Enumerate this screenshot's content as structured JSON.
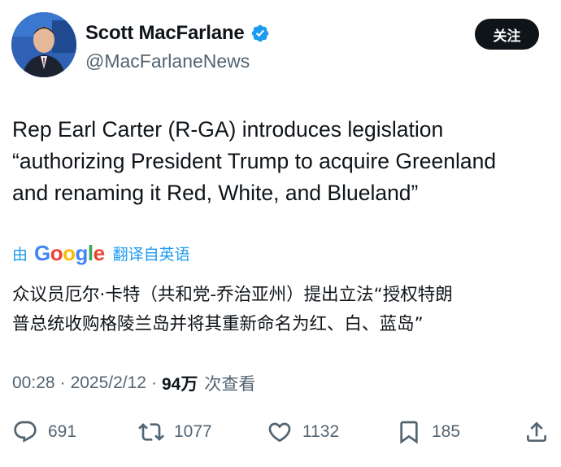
{
  "author": {
    "name": "Scott MacFarlane",
    "handle": "@MacFarlaneNews"
  },
  "follow_label": "关注",
  "tweet_text": "Rep Earl Carter (R-GA) introduces legislation\n“authorizing President Trump to acquire Greenland\nand renaming it Red, White, and Blueland”",
  "translation": {
    "prefix": "由",
    "logo_text": "Google",
    "suffix": "翻译自英语",
    "text": "众议员厄尔·卡特（共和党-乔治亚州）提出立法“授权特朗\n普总统收购格陵兰岛并将其重新命名为红、白、蓝岛”"
  },
  "meta": {
    "time": "00:28",
    "separator": "·",
    "date": "2025/2/12",
    "views": "94万",
    "views_label": "次查看"
  },
  "actions": {
    "replies": "691",
    "reposts": "1077",
    "likes": "1132",
    "bookmarks": "185"
  },
  "colors": {
    "verified_blue": "#1d9bf0",
    "link_blue": "#1d9bf0",
    "muted_gray": "#536471",
    "text_black": "#0f1419"
  },
  "icons": [
    "verified-badge-icon",
    "reply-icon",
    "repost-icon",
    "like-icon",
    "bookmark-icon",
    "share-icon"
  ]
}
